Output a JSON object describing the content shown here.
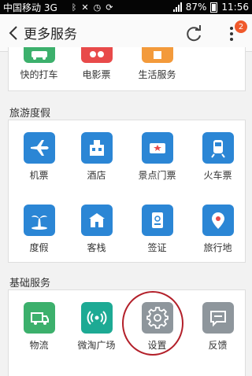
{
  "status_bar": {
    "carrier": "中国移动 3G",
    "battery": "87%",
    "time": "11:56"
  },
  "header": {
    "title": "更多服务",
    "back_icon": "chevron-left-icon",
    "refresh_icon": "refresh-icon",
    "more_icon": "more-vertical-icon",
    "badge_count": "2"
  },
  "top_section": {
    "items": [
      {
        "label": "快的打车",
        "icon": "car-icon",
        "color": "#3cb06c"
      },
      {
        "label": "电影票",
        "icon": "movie-ticket-icon",
        "color": "#e84a4a"
      },
      {
        "label": "生活服务",
        "icon": "home-service-icon",
        "color": "#f39a3b"
      }
    ]
  },
  "travel": {
    "title": "旅游度假",
    "items": [
      {
        "label": "机票",
        "icon": "airplane-icon",
        "color": "#2b86d5"
      },
      {
        "label": "酒店",
        "icon": "hotel-icon",
        "color": "#2b86d5"
      },
      {
        "label": "景点门票",
        "icon": "ticket-icon",
        "color": "#2b86d5"
      },
      {
        "label": "火车票",
        "icon": "train-icon",
        "color": "#2b86d5"
      },
      {
        "label": "度假",
        "icon": "palm-tree-icon",
        "color": "#2b86d5"
      },
      {
        "label": "客栈",
        "icon": "inn-icon",
        "color": "#2b86d5"
      },
      {
        "label": "签证",
        "icon": "visa-icon",
        "color": "#2b86d5"
      },
      {
        "label": "旅行地",
        "icon": "location-pin-icon",
        "color": "#2b86d5"
      }
    ]
  },
  "basic": {
    "title": "基础服务",
    "items": [
      {
        "label": "物流",
        "icon": "truck-icon",
        "color": "#3cb06c"
      },
      {
        "label": "微淘广场",
        "icon": "broadcast-icon",
        "color": "#1daa94"
      },
      {
        "label": "设置",
        "icon": "gear-icon",
        "color": "#8e969c"
      },
      {
        "label": "反馈",
        "icon": "feedback-icon",
        "color": "#8e969c"
      }
    ]
  }
}
